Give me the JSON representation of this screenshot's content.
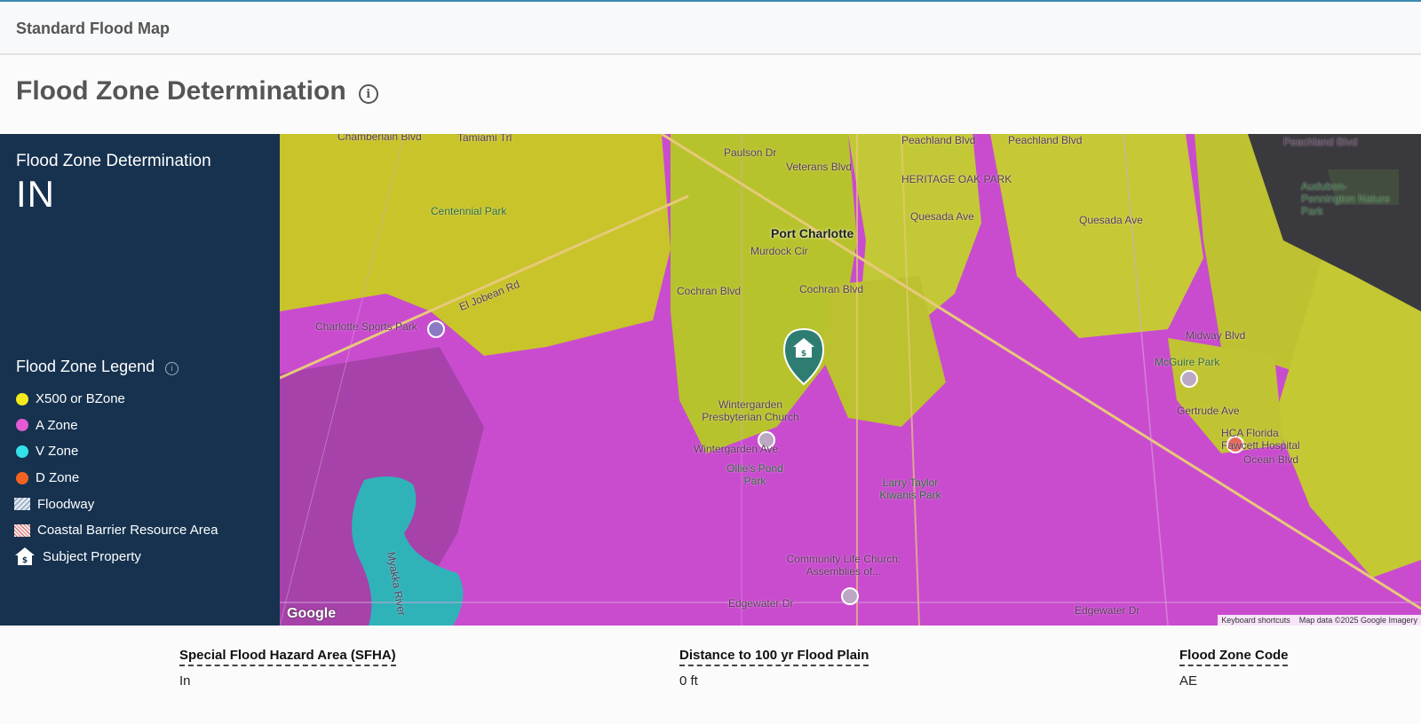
{
  "header": {
    "title": "Standard Flood Map"
  },
  "page": {
    "title": "Flood Zone Determination"
  },
  "panel": {
    "determination_label": "Flood Zone Determination",
    "determination_value": "IN",
    "legend_title": "Flood Zone Legend",
    "legend": [
      {
        "label": "X500 or BZone",
        "color": "#f4ea1c"
      },
      {
        "label": "A Zone",
        "color": "#e35ad2"
      },
      {
        "label": "V Zone",
        "color": "#34e1e8"
      },
      {
        "label": "D Zone",
        "color": "#f26322"
      },
      {
        "label": "Floodway",
        "icon": "floodway-hatch"
      },
      {
        "label": "Coastal Barrier Resource Area",
        "icon": "cbra-hatch"
      },
      {
        "label": "Subject Property",
        "icon": "house-icon"
      }
    ]
  },
  "map": {
    "labels": {
      "chamberlain": "Chamberlain Blvd",
      "tamiami": "Tamiami Trl",
      "peachland1": "Peachland Blvd",
      "peachland2": "Peachland Blvd",
      "peachland3": "Peachland Blvd",
      "centennial": "Centennial Park",
      "port_charlotte": "Port Charlotte",
      "heritage": "HERITAGE OAK PARK",
      "quesada1": "Quesada Ave",
      "quesada2": "Quesada Ave",
      "audubon": "Audubon-Pennington Nature Park",
      "cochran1": "Cochran Blvd",
      "cochran2": "Cochran Blvd",
      "murdock": "Murdock Cir",
      "eljobean": "El Jobean Rd",
      "sports_park": "Charlotte Sports Park",
      "midway": "Midway Blvd",
      "mcguire": "McGuire Park",
      "wintergarden_church": "Wintergarden Presbyterian Church",
      "wintergarden_ave": "Wintergarden Ave",
      "ollies": "Ollie's Pond Park",
      "larry_taylor": "Larry Taylor Kiwanis Park",
      "hca": "HCA Florida Fawcett Hospital",
      "gertrude": "Gertrude Ave",
      "ocean": "Ocean Blvd",
      "community": "Community Life Church: Assemblies of...",
      "edgewater1": "Edgewater Dr",
      "edgewater2": "Edgewater Dr",
      "myakka": "Myakka River",
      "veterans": "Veterans Blvd",
      "paulson": "Paulson Dr"
    },
    "google_logo": "Google",
    "keyboard_shortcuts": "Keyboard shortcuts",
    "map_data": "Map data ©2025 Google Imagery"
  },
  "info": {
    "sfha_label": "Special Flood Hazard Area (SFHA)",
    "sfha_value": "In",
    "distance_label": "Distance to 100 yr Flood Plain",
    "distance_value": "0 ft",
    "code_label": "Flood Zone Code",
    "code_value": "AE"
  },
  "colors": {
    "panel_bg": "#16324f",
    "zone_x500": "#c8c42a",
    "zone_a": "#c94ccf",
    "zone_v": "#2fb3b8",
    "marker": "#2e7d72"
  }
}
